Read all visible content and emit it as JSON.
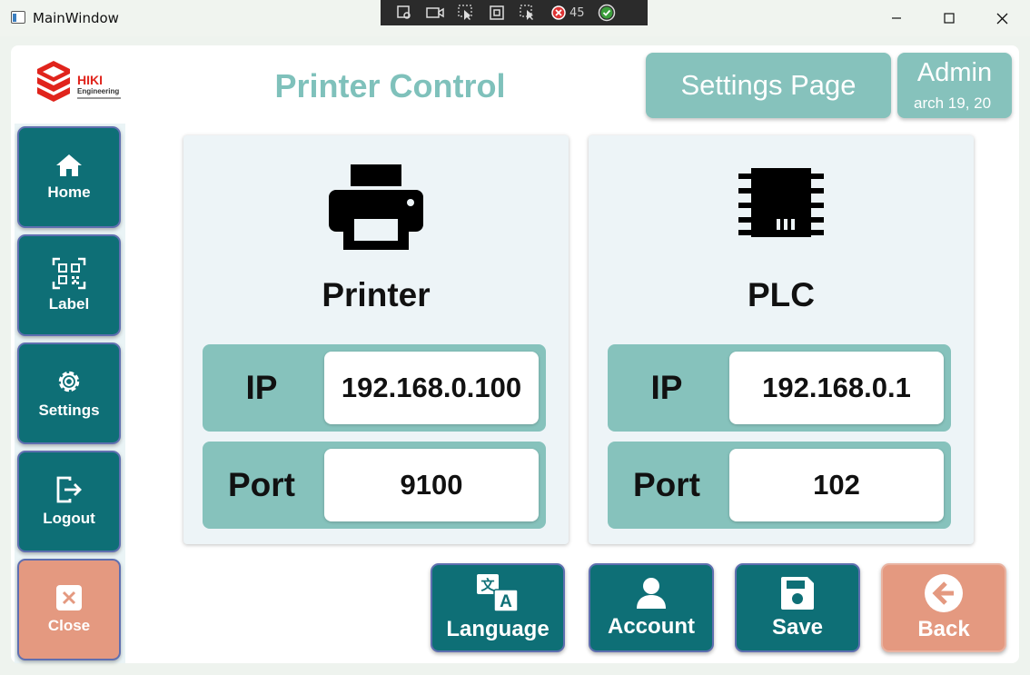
{
  "window": {
    "title": "MainWindow"
  },
  "devtools": {
    "count": "45"
  },
  "header": {
    "page_title": "Printer Control",
    "settings_label": "Settings Page",
    "user": "Admin",
    "date_fragment": "arch 19, 20"
  },
  "logo": {
    "brand": "HIKI",
    "sub": "Engineering"
  },
  "sidebar": {
    "items": [
      {
        "label": "Home",
        "icon": "home-icon"
      },
      {
        "label": "Label",
        "icon": "qr-code-icon"
      },
      {
        "label": "Settings",
        "icon": "gear-icon"
      },
      {
        "label": "Logout",
        "icon": "logout-icon"
      },
      {
        "label": "Close",
        "icon": "close-icon"
      }
    ]
  },
  "cards": {
    "printer": {
      "title": "Printer",
      "ip_label": "IP",
      "ip_value": "192.168.0.100",
      "port_label": "Port",
      "port_value": "9100"
    },
    "plc": {
      "title": "PLC",
      "ip_label": "IP",
      "ip_value": "192.168.0.1",
      "port_label": "Port",
      "port_value": "102"
    }
  },
  "actions": {
    "language": "Language",
    "account": "Account",
    "save": "Save",
    "back": "Back"
  },
  "colors": {
    "primary": "#0e6f76",
    "accent": "#86c2bc",
    "danger": "#e49980",
    "title": "#7fc1bb"
  }
}
